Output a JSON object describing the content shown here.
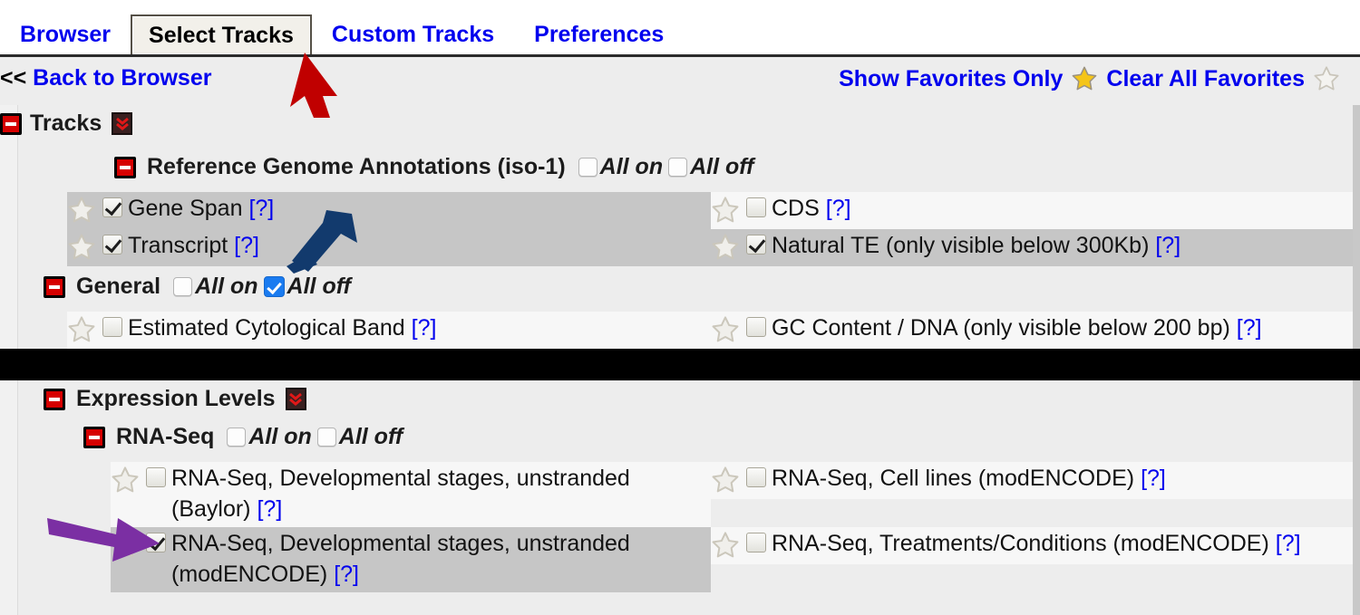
{
  "tabs": [
    {
      "label": "Browser",
      "active": false
    },
    {
      "label": "Select Tracks",
      "active": true
    },
    {
      "label": "Custom Tracks",
      "active": false
    },
    {
      "label": "Preferences",
      "active": false
    }
  ],
  "subheader": {
    "back_chevrons": "<<",
    "back_label": "Back to Browser",
    "show_favorites_label": "Show Favorites Only",
    "clear_favorites_label": "Clear All Favorites"
  },
  "tracks_header": {
    "title": "Tracks"
  },
  "expression_header": {
    "title": "Expression Levels"
  },
  "groups": {
    "reference": {
      "title": "Reference Genome Annotations (iso-1)",
      "all_on_label": "All on",
      "all_off_label": "All off",
      "all_on_checked": false,
      "all_off_checked": false
    },
    "general": {
      "title": "General",
      "all_on_label": "All on",
      "all_off_label": "All off",
      "all_on_checked": false,
      "all_off_checked": true
    },
    "rnaseq": {
      "title": "RNA-Seq",
      "all_on_label": "All on",
      "all_off_label": "All off",
      "all_on_checked": false,
      "all_off_checked": false
    }
  },
  "help_marker": "[?]",
  "reference_rows": [
    {
      "left_label": "Gene Span",
      "left_checked": true,
      "left_selected": true,
      "right_label": "CDS",
      "right_checked": false,
      "right_selected": false
    },
    {
      "left_label": "Transcript",
      "left_checked": true,
      "left_selected": true,
      "right_label": "Natural TE (only visible below 300Kb)",
      "right_checked": true,
      "right_selected": true
    }
  ],
  "general_rows": [
    {
      "left_label": "Estimated Cytological Band",
      "left_checked": false,
      "left_selected": false,
      "right_label": "GC Content / DNA (only visible below 200 bp)",
      "right_checked": false,
      "right_selected": false
    }
  ],
  "rnaseq_rows": [
    {
      "left_label": "RNA-Seq, Developmental stages, unstranded (Baylor)",
      "left_checked": false,
      "left_selected": false,
      "right_label": "RNA-Seq, Cell lines (modENCODE)",
      "right_checked": false,
      "right_selected": false
    },
    {
      "left_label": "RNA-Seq, Developmental stages, unstranded (modENCODE)",
      "left_checked": true,
      "left_selected": true,
      "right_label": "RNA-Seq, Treatments/Conditions (modENCODE)",
      "right_checked": false,
      "right_selected": false
    }
  ],
  "annotations": {
    "red_arrow_color": "#c00000",
    "blue_arrow_color": "#123a6d",
    "purple_arrow_color": "#7b2fa3"
  },
  "colors": {
    "link": "#0000ee",
    "star_filled": "#f5c518",
    "star_outline": "#d8d5cc",
    "selected_row": "#c6c6c6",
    "page_background": "#ededed"
  }
}
